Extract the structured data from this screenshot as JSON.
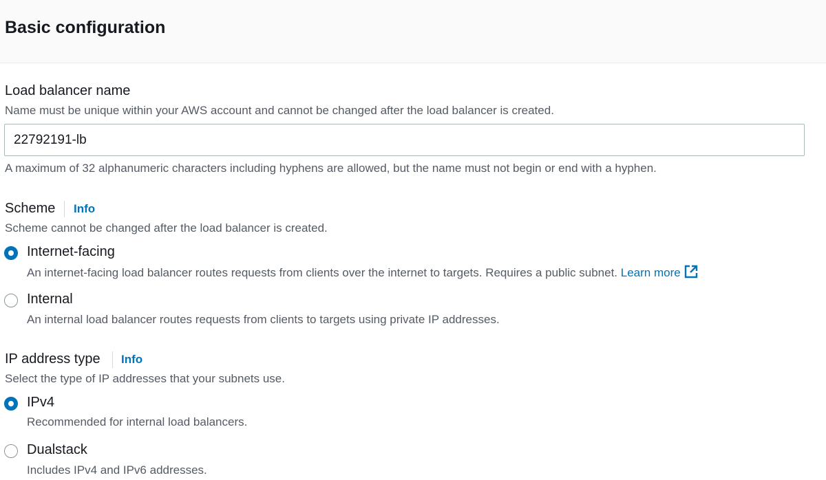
{
  "section": {
    "title": "Basic configuration"
  },
  "name_field": {
    "label": "Load balancer name",
    "description": "Name must be unique within your AWS account and cannot be changed after the load balancer is created.",
    "value": "22792191-lb",
    "constraint": "A maximum of 32 alphanumeric characters including hyphens are allowed, but the name must not begin or end with a hyphen."
  },
  "scheme": {
    "label": "Scheme",
    "info": "Info",
    "description": "Scheme cannot be changed after the load balancer is created.",
    "options": [
      {
        "label": "Internet-facing",
        "description": "An internet-facing load balancer routes requests from clients over the internet to targets. Requires a public subnet.",
        "link": "Learn more",
        "selected": true
      },
      {
        "label": "Internal",
        "description": "An internal load balancer routes requests from clients to targets using private IP addresses.",
        "selected": false
      }
    ]
  },
  "ip_type": {
    "label": "IP address type",
    "info": "Info",
    "description": "Select the type of IP addresses that your subnets use.",
    "options": [
      {
        "label": "IPv4",
        "description": "Recommended for internal load balancers.",
        "selected": true
      },
      {
        "label": "Dualstack",
        "description": "Includes IPv4 and IPv6 addresses.",
        "selected": false
      }
    ]
  },
  "colors": {
    "accent": "#0073bb",
    "text": "#16191f",
    "secondary_text": "#545b64",
    "header_bg": "#fafafa"
  },
  "icons": {
    "external_link": "external-link-icon"
  }
}
